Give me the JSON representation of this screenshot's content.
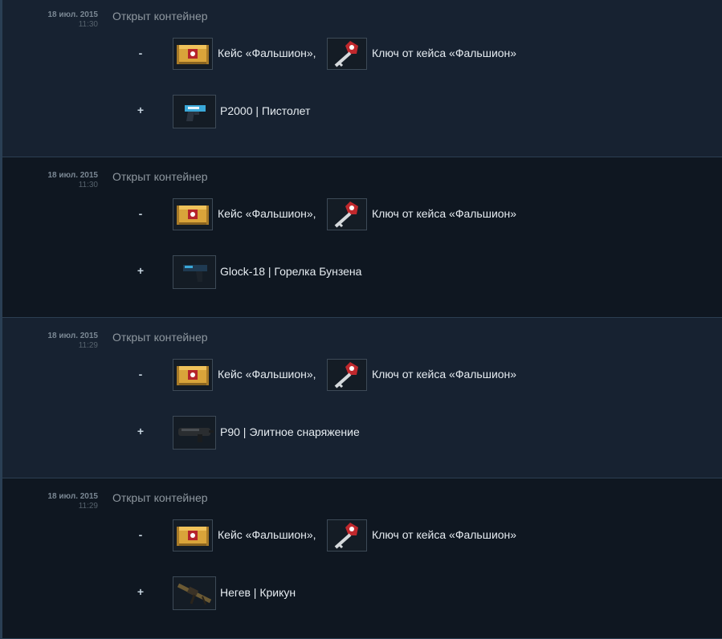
{
  "history": [
    {
      "date": "18 июл. 2015",
      "time": "11:30",
      "description": "Открыт контейнер",
      "minus_sign": "-",
      "plus_sign": "+",
      "lost": [
        {
          "name": "Кейс «Фальшион»,",
          "icon": "falchion-case-icon"
        },
        {
          "name": "Ключ от кейса «Фальшион»",
          "icon": "falchion-case-key-icon"
        }
      ],
      "gained": {
        "name": "P2000 | Пистолет",
        "icon": "p2000-pistol-icon"
      }
    },
    {
      "date": "18 июл. 2015",
      "time": "11:30",
      "description": "Открыт контейнер",
      "minus_sign": "-",
      "plus_sign": "+",
      "lost": [
        {
          "name": "Кейс «Фальшион»,",
          "icon": "falchion-case-icon"
        },
        {
          "name": "Ключ от кейса «Фальшион»",
          "icon": "falchion-case-key-icon"
        }
      ],
      "gained": {
        "name": "Glock-18 | Горелка Бунзена",
        "icon": "glock-18-pistol-icon"
      }
    },
    {
      "date": "18 июл. 2015",
      "time": "11:29",
      "description": "Открыт контейнер",
      "minus_sign": "-",
      "plus_sign": "+",
      "lost": [
        {
          "name": "Кейс «Фальшион»,",
          "icon": "falchion-case-icon"
        },
        {
          "name": "Ключ от кейса «Фальшион»",
          "icon": "falchion-case-key-icon"
        }
      ],
      "gained": {
        "name": "P90 | Элитное снаряжение",
        "icon": "p90-smg-icon"
      }
    },
    {
      "date": "18 июл. 2015",
      "time": "11:29",
      "description": "Открыт контейнер",
      "minus_sign": "-",
      "plus_sign": "+",
      "lost": [
        {
          "name": "Кейс «Фальшион»,",
          "icon": "falchion-case-icon"
        },
        {
          "name": "Ключ от кейса «Фальшион»",
          "icon": "falchion-case-key-icon"
        }
      ],
      "gained": {
        "name": "Негев | Крикун",
        "icon": "negev-mg-icon"
      }
    }
  ],
  "colors": {
    "page_background": "#1b2838",
    "row_odd": "#172231",
    "row_even": "#0f1721",
    "case_gold": "#d9a43a",
    "key_red": "#c0282d"
  }
}
